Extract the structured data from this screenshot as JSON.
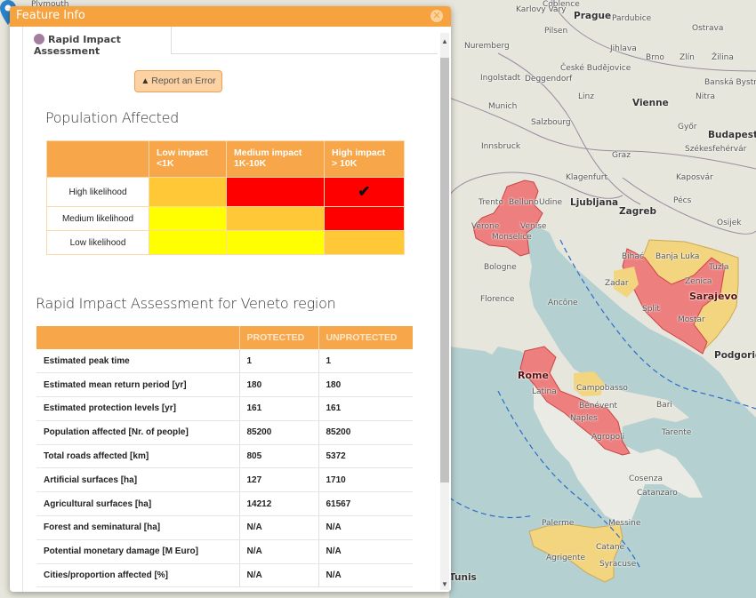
{
  "dialog": {
    "title": "Feature Info",
    "close_icon": "close-circle-icon"
  },
  "tabs": [
    {
      "label": "Rapid Impact Assessment",
      "icon": "circle-dot-icon",
      "active": true
    }
  ],
  "report_button": {
    "label": "Report an Error",
    "icon": "warning-triangle-icon"
  },
  "population_affected": {
    "title": "Population Affected",
    "columns": [
      {
        "line1": "Low impact",
        "line2": "<1K"
      },
      {
        "line1": "Medium impact",
        "line2": "1K-10K"
      },
      {
        "line1": "High impact",
        "line2": "> 10K"
      }
    ],
    "rows": [
      {
        "label": "High likelihood",
        "cells": [
          "#ffc837",
          "#ff0000",
          "#ff0000"
        ],
        "checked_column": 2
      },
      {
        "label": "Medium likelihood",
        "cells": [
          "#ffff00",
          "#ffc837",
          "#ff0000"
        ]
      },
      {
        "label": "Low likelihood",
        "cells": [
          "#ffff00",
          "#ffff00",
          "#ffc837"
        ]
      }
    ],
    "check_icon": "checkmark-icon"
  },
  "assessment": {
    "title": "Rapid Impact Assessment for Veneto region",
    "headers": [
      "",
      "PROTECTED",
      "UNPROTECTED"
    ],
    "rows": [
      {
        "label": "Estimated peak time",
        "protected": "1",
        "unprotected": "1"
      },
      {
        "label": "Estimated mean return period [yr]",
        "protected": "180",
        "unprotected": "180"
      },
      {
        "label": "Estimated protection levels [yr]",
        "protected": "161",
        "unprotected": "161"
      },
      {
        "label": "Population affected [Nr. of people]",
        "protected": "85200",
        "unprotected": "85200"
      },
      {
        "label": "Total roads affected [km]",
        "protected": "805",
        "unprotected": "5372"
      },
      {
        "label": "Artificial surfaces [ha]",
        "protected": "127",
        "unprotected": "1710"
      },
      {
        "label": "Agricultural surfaces [ha]",
        "protected": "14212",
        "unprotected": "61567"
      },
      {
        "label": "Forest and seminatural [ha]",
        "protected": "N/A",
        "unprotected": "N/A"
      },
      {
        "label": "Potential monetary damage [M Euro]",
        "protected": "N/A",
        "unprotected": "N/A"
      },
      {
        "label": "Cities/proportion affected [%]",
        "protected": "N/A",
        "unprotected": "N/A"
      }
    ]
  },
  "colors": {
    "header_orange": "#f5a23f",
    "high_risk": "#ff0000",
    "medium_risk": "#ffc837",
    "low_risk": "#ffff00",
    "map_region_red": "#ee7f7f",
    "map_region_yellow": "#f2d57e"
  },
  "map": {
    "labels": [
      {
        "text": "Plymouth",
        "cls": ""
      },
      {
        "text": "Coblence",
        "cls": ""
      },
      {
        "text": "Prague",
        "cls": "big"
      },
      {
        "text": "Karlovy Vary",
        "cls": ""
      },
      {
        "text": "Pardubice",
        "cls": ""
      },
      {
        "text": "Nuremberg",
        "cls": ""
      },
      {
        "text": "Pilsen",
        "cls": ""
      },
      {
        "text": "Jihlava",
        "cls": ""
      },
      {
        "text": "Brno",
        "cls": ""
      },
      {
        "text": "Ostrava",
        "cls": ""
      },
      {
        "text": "Zlín",
        "cls": ""
      },
      {
        "text": "Žilina",
        "cls": ""
      },
      {
        "text": "České Budějovice",
        "cls": ""
      },
      {
        "text": "Ingolstadt",
        "cls": ""
      },
      {
        "text": "Deggendorf",
        "cls": ""
      },
      {
        "text": "Banská Bystrica",
        "cls": ""
      },
      {
        "text": "Linz",
        "cls": ""
      },
      {
        "text": "Munich",
        "cls": ""
      },
      {
        "text": "Vienne",
        "cls": "big"
      },
      {
        "text": "Nitra",
        "cls": ""
      },
      {
        "text": "Salzbourg",
        "cls": ""
      },
      {
        "text": "Győr",
        "cls": ""
      },
      {
        "text": "Budapest",
        "cls": "big"
      },
      {
        "text": "Innsbruck",
        "cls": ""
      },
      {
        "text": "Graz",
        "cls": ""
      },
      {
        "text": "Székesfehérvár",
        "cls": ""
      },
      {
        "text": "Klagenfurt",
        "cls": ""
      },
      {
        "text": "Ljubljana",
        "cls": "big"
      },
      {
        "text": "Zagreb",
        "cls": "big"
      },
      {
        "text": "Kaposvár",
        "cls": ""
      },
      {
        "text": "Pécs",
        "cls": ""
      },
      {
        "text": "Trento",
        "cls": ""
      },
      {
        "text": "Belluno",
        "cls": ""
      },
      {
        "text": "Udine",
        "cls": ""
      },
      {
        "text": "Vérone",
        "cls": ""
      },
      {
        "text": "Venise",
        "cls": ""
      },
      {
        "text": "Monselice",
        "cls": ""
      },
      {
        "text": "Osijek",
        "cls": ""
      },
      {
        "text": "Bologne",
        "cls": ""
      },
      {
        "text": "Bihać",
        "cls": ""
      },
      {
        "text": "Banja Luka",
        "cls": ""
      },
      {
        "text": "Tuzla",
        "cls": ""
      },
      {
        "text": "Zenica",
        "cls": ""
      },
      {
        "text": "Sarajevo",
        "cls": "capital"
      },
      {
        "text": "Zadar",
        "cls": ""
      },
      {
        "text": "Split",
        "cls": ""
      },
      {
        "text": "Mostar",
        "cls": ""
      },
      {
        "text": "Florence",
        "cls": ""
      },
      {
        "text": "Ancône",
        "cls": ""
      },
      {
        "text": "Podgorica",
        "cls": "big"
      },
      {
        "text": "Rome",
        "cls": "capital"
      },
      {
        "text": "Latina",
        "cls": ""
      },
      {
        "text": "Campobasso",
        "cls": ""
      },
      {
        "text": "Bénévent",
        "cls": ""
      },
      {
        "text": "Naples",
        "cls": ""
      },
      {
        "text": "Bari",
        "cls": ""
      },
      {
        "text": "Tarente",
        "cls": ""
      },
      {
        "text": "Agropoli",
        "cls": ""
      },
      {
        "text": "Cosenza",
        "cls": ""
      },
      {
        "text": "Catanzaro",
        "cls": ""
      },
      {
        "text": "Palerme",
        "cls": ""
      },
      {
        "text": "Messine",
        "cls": ""
      },
      {
        "text": "Catane",
        "cls": ""
      },
      {
        "text": "Agrigente",
        "cls": ""
      },
      {
        "text": "Syracuse",
        "cls": ""
      },
      {
        "text": "Tunis",
        "cls": "big"
      }
    ]
  }
}
